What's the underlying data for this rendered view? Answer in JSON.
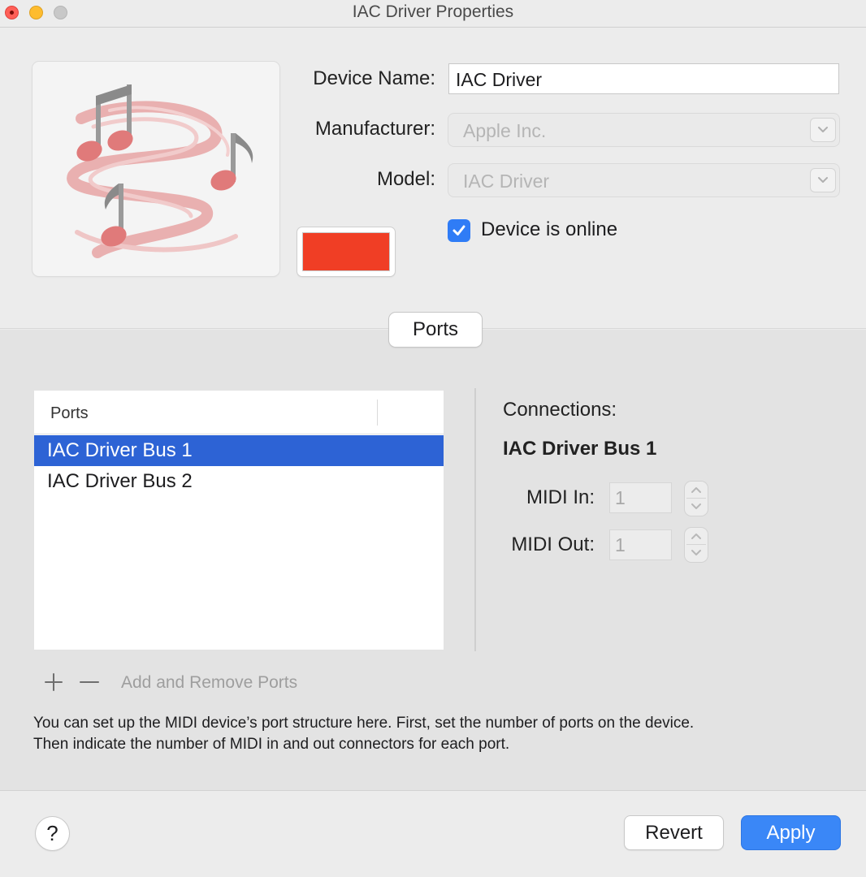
{
  "window": {
    "title": "IAC Driver Properties"
  },
  "device": {
    "name_label": "Device Name:",
    "name_value": "IAC Driver",
    "manufacturer_label": "Manufacturer:",
    "manufacturer_value": "Apple Inc.",
    "model_label": "Model:",
    "model_value": "IAC Driver",
    "online_label": "Device is online",
    "online_checked": true,
    "icon": "midi-music-notes-icon",
    "color": "#f03e25"
  },
  "tabs": {
    "ports": "Ports"
  },
  "ports_table": {
    "header": "Ports",
    "rows": [
      "IAC Driver Bus 1",
      "IAC Driver Bus 2"
    ],
    "selected_index": 0
  },
  "connections": {
    "title": "Connections:",
    "port_name": "IAC Driver Bus 1",
    "midi_in_label": "MIDI In:",
    "midi_in_value": "1",
    "midi_out_label": "MIDI Out:",
    "midi_out_value": "1"
  },
  "port_controls": {
    "add_icon": "plus-icon",
    "remove_icon": "minus-icon",
    "label": "Add and Remove Ports"
  },
  "help": {
    "line1": "You can set up the MIDI device’s port structure here. First, set the number of ports on the device.",
    "line2": "Then indicate the number of MIDI in and out connectors for each port.",
    "button": "?"
  },
  "buttons": {
    "revert": "Revert",
    "apply": "Apply"
  },
  "colors": {
    "accent": "#3a87f7",
    "selection": "#2d63d5"
  }
}
